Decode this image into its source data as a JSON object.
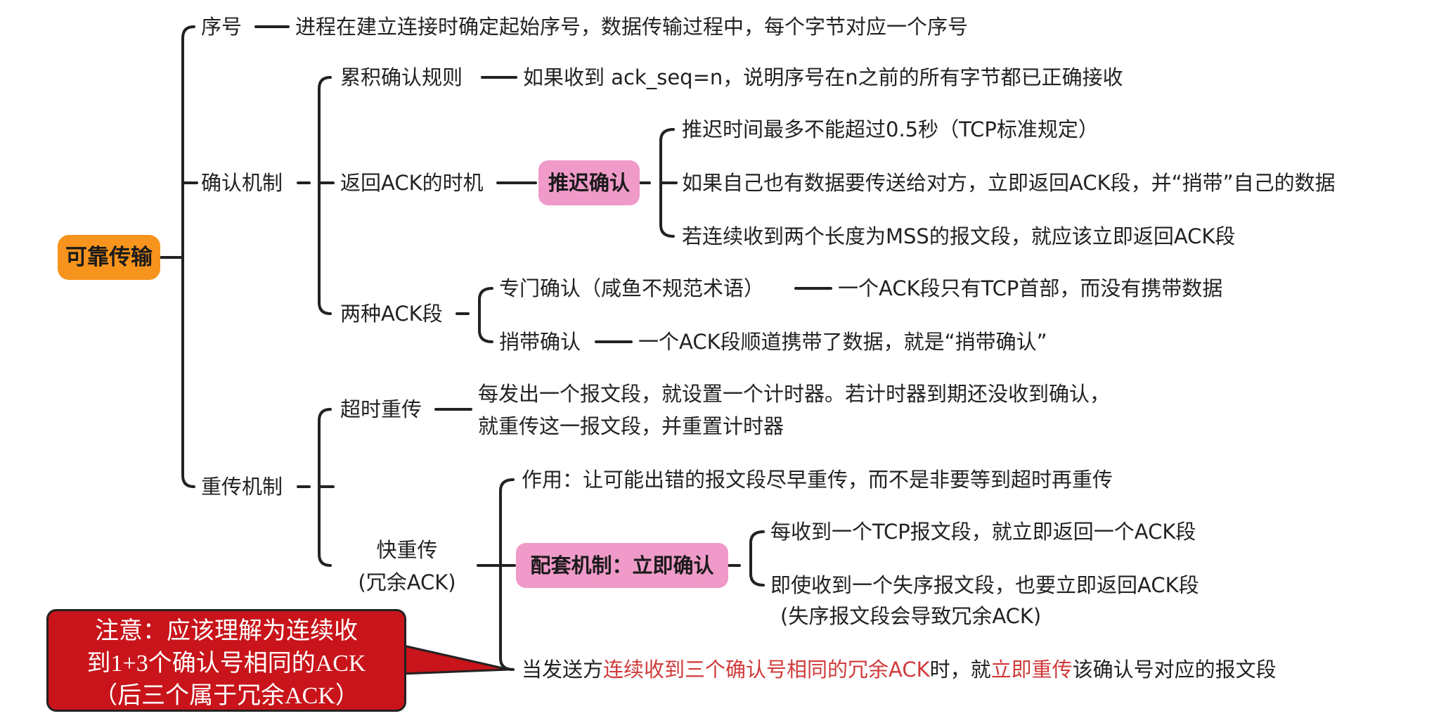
{
  "root": {
    "label": "可靠传输"
  },
  "seq": {
    "label": "序号",
    "desc": "进程在建立连接时确定起始序号，数据传输过程中，每个字节对应一个序号"
  },
  "ack": {
    "label": "确认机制",
    "cumulative": {
      "label": "累积确认规则",
      "desc": "如果收到 ack_seq=n，说明序号在n之前的所有字节都已正确接收"
    },
    "timing": {
      "label": "返回ACK的时机",
      "delayed": "推迟确认",
      "items": [
        "推迟时间最多不能超过0.5秒（TCP标准规定）",
        "如果自己也有数据要传送给对方，立即返回ACK段，并“捎带”自己的数据",
        "若连续收到两个长度为MSS的报文段，就应该立即返回ACK段"
      ]
    },
    "types": {
      "label": "两种ACK段",
      "pure": {
        "label": "专门确认（咸鱼不规范术语）",
        "desc": "一个ACK段只有TCP首部，而没有携带数据"
      },
      "piggyback": {
        "label": "捎带确认",
        "desc": "一个ACK段顺道携带了数据，就是“捎带确认”"
      }
    }
  },
  "retx": {
    "label": "重传机制",
    "timeout": {
      "label": "超时重传",
      "desc_line1": "每发出一个报文段，就设置一个计时器。若计时器到期还没收到确认，",
      "desc_line2": "就重传这一报文段，并重置计时器"
    },
    "fast": {
      "label_line1": "快重传",
      "label_line2": "(冗余ACK)",
      "purpose": "作用：让可能出错的报文段尽早重传，而不是非要等到超时再重传",
      "support": "配套机制：立即确认",
      "support_items": [
        "每收到一个TCP报文段，就立即返回一个ACK段",
        "即使收到一个失序报文段，也要立即返回ACK段",
        "(失序报文段会导致冗余ACK)"
      ],
      "rule_a": "当发送方",
      "rule_b": "连续收到三个确认号相同的冗余ACK",
      "rule_c": "时，就",
      "rule_d": "立即重传",
      "rule_e": "该确认号对应的报文段"
    }
  },
  "note": {
    "line1": "注意：应该理解为连续收",
    "line2": "到1+3个确认号相同的ACK",
    "line3": "（后三个属于冗余ACK）"
  },
  "colors": {
    "root_fill": "#f7941d",
    "pill_fill": "#ef9ac8",
    "note_fill": "#c8141a",
    "highlight_text": "#d03a3a"
  }
}
